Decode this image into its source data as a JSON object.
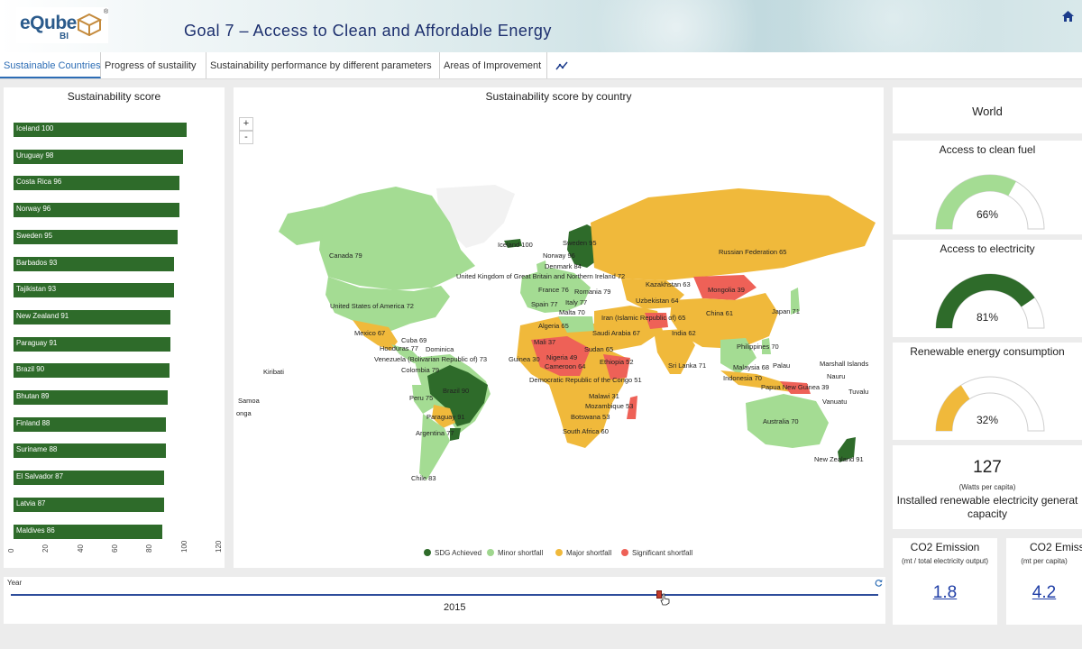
{
  "header": {
    "logo_main": "eQube",
    "logo_sub": "BI",
    "logo_reg": "®",
    "title": "Goal 7 – Access to Clean and Affordable Energy"
  },
  "tabs": [
    {
      "label": "Sustainable Countries",
      "active": true
    },
    {
      "label": "Progress of sustaility",
      "active": false
    },
    {
      "label": "Sustainability performance by different parameters",
      "active": false
    },
    {
      "label": "Areas of Improvement",
      "active": false
    }
  ],
  "score_panel": {
    "title": "Sustainability score",
    "bars": [
      {
        "label": "Iceland 100",
        "value": 100
      },
      {
        "label": "Uruguay 98",
        "value": 98
      },
      {
        "label": "Costa Rica 96",
        "value": 96
      },
      {
        "label": "Norway 96",
        "value": 96
      },
      {
        "label": "Sweden 95",
        "value": 95
      },
      {
        "label": "Barbados 93",
        "value": 93
      },
      {
        "label": "Tajikistan 93",
        "value": 93
      },
      {
        "label": "New Zealand 91",
        "value": 91
      },
      {
        "label": "Paraguay 91",
        "value": 91
      },
      {
        "label": "Brazil 90",
        "value": 90
      },
      {
        "label": "Bhutan 89",
        "value": 89
      },
      {
        "label": "Finland 88",
        "value": 88
      },
      {
        "label": "Suriname 88",
        "value": 88
      },
      {
        "label": "El Salvador 87",
        "value": 87
      },
      {
        "label": "Latvia 87",
        "value": 87
      },
      {
        "label": "Maldives 86",
        "value": 86
      }
    ],
    "ticks": [
      "0",
      "20",
      "40",
      "60",
      "80",
      "100",
      "120"
    ],
    "max": 120,
    "bar_color": "#2e6b2a"
  },
  "map_panel": {
    "title": "Sustainability score by country",
    "zoom_in": "+",
    "zoom_out": "-",
    "labels": [
      "Iceland 100",
      "Sweden 95",
      "Norway 96",
      "Denmark 84",
      "Canada 79",
      "United Kingdom of Great Britain and Northern Ireland 72",
      "France 76",
      "Romania 79",
      "Spain 77",
      "Italy 77",
      "Malta 70",
      "Russian Federation 65",
      "Kazakhstan 63",
      "Mongolia 39",
      "Uzbekistan 64",
      "Iran (Islamic Republic of) 65",
      "China 61",
      "Japan 71",
      "United States of America 72",
      "Mexico 67",
      "Cuba 69",
      "Honduras 77",
      "Dominica",
      "Venezuela (Bolivarian Republic of) 73",
      "Colombia 79",
      "Algeria 65",
      "Saudi Arabia 67",
      "India 62",
      "Mali 37",
      "Sudan 65",
      "Guinea 30",
      "Nigeria 49",
      "Ethiopia 52",
      "Cameroon 64",
      "Philippines 70",
      "Sri Lanka 71",
      "Malaysia 68",
      "Palau",
      "Marshall Islands",
      "Nauru",
      "Indonesia 70",
      "Democratic Republic of the Congo 51",
      "Kiribati",
      "Brazil 90",
      "Peru 75",
      "Malawi 31",
      "Mozambique 53",
      "Papua New Guinea 39",
      "Tuvalu",
      "Vanuatu",
      "Samoa",
      "onga",
      "Paraguay 91",
      "Botswana 53",
      "Australia 70",
      "Argentina 77",
      "South Africa 60",
      "Chile 83",
      "New Zealand 91"
    ],
    "legend": [
      {
        "label": "SDG Achieved",
        "color": "#2e6b2a"
      },
      {
        "label": "Minor shortfall",
        "color": "#9fd68e"
      },
      {
        "label": "Major shortfall",
        "color": "#f0b93b"
      },
      {
        "label": "Significant shortfall",
        "color": "#ee6157"
      }
    ]
  },
  "right": {
    "world": "World",
    "clean_fuel": {
      "title": "Access to clean fuel",
      "value": "66%",
      "fraction": 0.66,
      "color": "#a4dc93"
    },
    "electricity": {
      "title": "Access to electricity",
      "value": "81%",
      "fraction": 0.81,
      "color": "#2e6b2a"
    },
    "renewable": {
      "title": "Renewable energy consumption",
      "value": "32%",
      "fraction": 0.32,
      "color": "#f0b93b"
    },
    "capacity": {
      "value": "127",
      "unit": "(Watts per capita)",
      "label_line1": "Installed renewable electricity generat",
      "label_line2": "capacity"
    },
    "co2_a": {
      "title": "CO2 Emission",
      "unit": "(mt / total electricity output)",
      "value": "1.8"
    },
    "co2_b": {
      "title": "CO2 Emissio",
      "unit": "(mt per capita)",
      "value": "4.2"
    }
  },
  "slider": {
    "label": "Year",
    "year": "2015",
    "reset_icon": "refresh-icon"
  }
}
